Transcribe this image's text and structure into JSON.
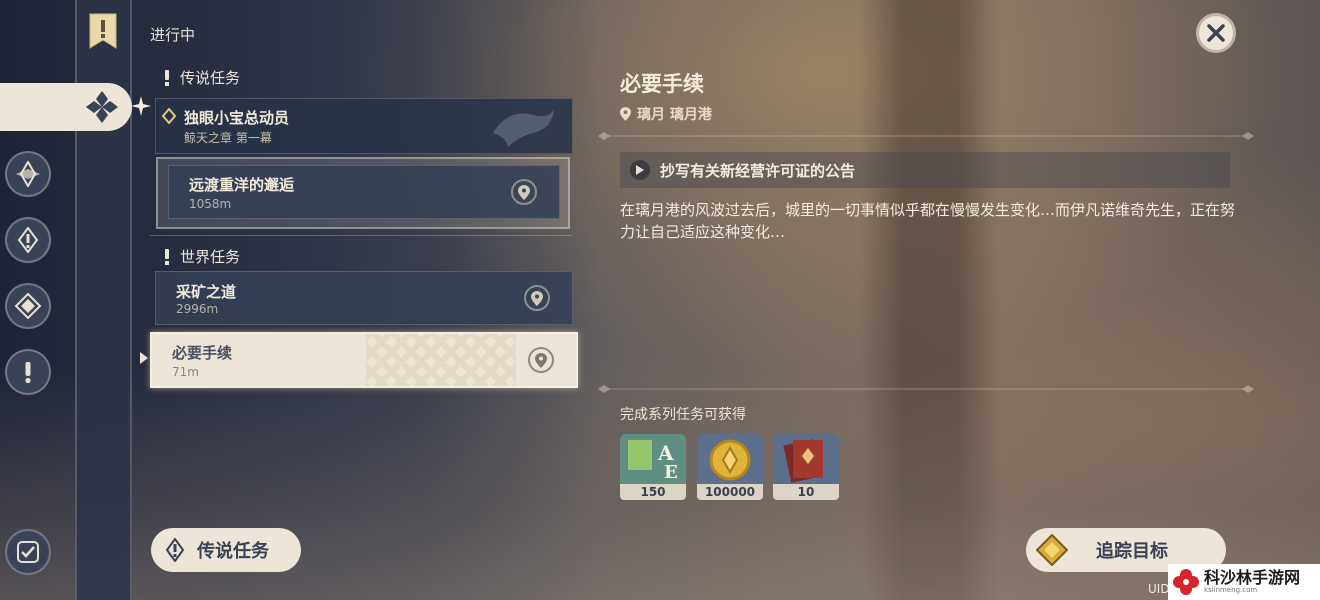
{
  "status_label": "进行中",
  "categories": {
    "legend": {
      "label": "传说任务"
    },
    "world": {
      "label": "世界任务"
    }
  },
  "legend_quest": {
    "title": "独眼小宝总动员",
    "chapter": "鲸天之章 第一幕",
    "subquest": {
      "title": "远渡重洋的邂逅",
      "distance": "1058m"
    }
  },
  "world_quests": [
    {
      "title": "采矿之道",
      "distance": "2996m"
    },
    {
      "title": "必要手续",
      "distance": "71m"
    }
  ],
  "detail": {
    "title": "必要手续",
    "location": "璃月 璃月港",
    "objective": "抄写有关新经营许可证的公告",
    "description": "在璃月港的风波过去后，城里的一切事情似乎都在慢慢发生变化…而伊凡诺维奇先生，正在努力让自己适应这种变化…",
    "rewards_title": "完成系列任务可获得",
    "rewards": [
      {
        "icon": "adventure-exp-icon",
        "count": "150"
      },
      {
        "icon": "mora-coin-icon",
        "count": "100000"
      },
      {
        "icon": "book-icon",
        "count": "10"
      }
    ]
  },
  "buttons": {
    "legend_filter": "传说任务",
    "track": "追踪目标"
  },
  "uid_label": "UID",
  "watermark": {
    "text": "科沙林手游网",
    "sub": "kslinmeng.com"
  },
  "colors": {
    "panel_light": "#ece5d8",
    "panel_dark": "#344056",
    "accent_gold": "#d9a93a"
  }
}
